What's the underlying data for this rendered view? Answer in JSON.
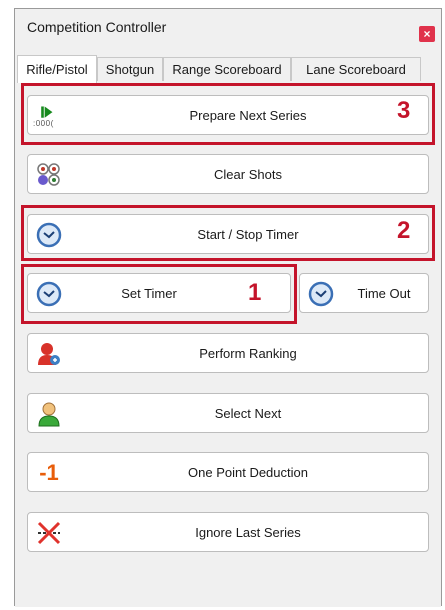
{
  "window": {
    "title": "Competition Controller",
    "close_glyph": "×"
  },
  "tabs": [
    {
      "label": "Rifle/Pistol",
      "active": true
    },
    {
      "label": "Shotgun",
      "active": false
    },
    {
      "label": "Range Scoreboard",
      "active": false
    },
    {
      "label": "Lane Scoreboard",
      "active": false
    }
  ],
  "buttons": {
    "prepare_next_series": {
      "label": "Prepare Next Series",
      "icon": "play-next-icon",
      "icon_caption": ":000("
    },
    "clear_shots": {
      "label": "Clear Shots",
      "icon": "targets-icon"
    },
    "start_stop_timer": {
      "label": "Start / Stop Timer",
      "icon": "clock-icon"
    },
    "set_timer": {
      "label": "Set Timer",
      "icon": "clock-icon"
    },
    "time_out": {
      "label": "Time Out",
      "icon": "clock-icon"
    },
    "perform_ranking": {
      "label": "Perform Ranking",
      "icon": "ranking-user-icon"
    },
    "select_next": {
      "label": "Select Next",
      "icon": "user-icon"
    },
    "one_point_deduction": {
      "label": "One Point Deduction",
      "icon": "minus-one-icon",
      "icon_text": "-1"
    },
    "ignore_last_series": {
      "label": "Ignore Last Series",
      "icon": "ignore-series-icon"
    }
  },
  "annotations": [
    {
      "number": "3",
      "target": "prepare_next_series"
    },
    {
      "number": "2",
      "target": "start_stop_timer"
    },
    {
      "number": "1",
      "target": "set_timer"
    }
  ],
  "colors": {
    "highlight": "#c4142b",
    "close": "#e0324b",
    "clock": "#3a6fb5",
    "minus_one": "#e85d0a"
  }
}
